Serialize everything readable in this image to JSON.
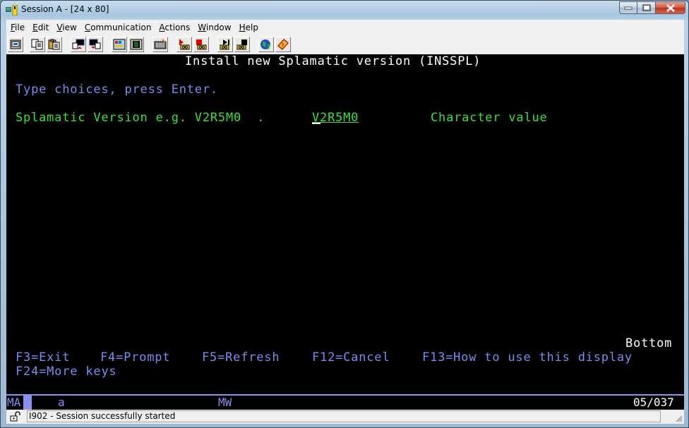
{
  "window": {
    "title": "Session A - [24 x 80]",
    "buttons": {
      "minimize": "minimize",
      "maximize": "maximize",
      "close": "close"
    }
  },
  "menubar": {
    "items": [
      {
        "label": "File",
        "accel": "F",
        "rest": "ile"
      },
      {
        "label": "Edit",
        "accel": "E",
        "rest": "dit"
      },
      {
        "label": "View",
        "accel": "V",
        "rest": "iew"
      },
      {
        "label": "Communication",
        "accel": "C",
        "rest": "ommunication"
      },
      {
        "label": "Actions",
        "accel": "A",
        "rest": "ctions"
      },
      {
        "label": "Window",
        "accel": "W",
        "rest": "indow"
      },
      {
        "label": "Help",
        "accel": "H",
        "rest": "elp"
      }
    ]
  },
  "toolbar": {
    "buttons": [
      "print-screen-icon",
      "copy-icon",
      "paste-icon",
      "send-icon",
      "receive-icon",
      "display-keypad-icon",
      "quick-keypad-icon",
      "keyboard-map-icon",
      "macro-record-icon",
      "macro-stop-icon",
      "macro-play-icon",
      "macro-pause-icon",
      "web-help-icon",
      "help-icon"
    ]
  },
  "terminal": {
    "title": "Install new Splamatic version (INSSPL)",
    "instruction": "Type choices, press Enter.",
    "prompt_label": "Splamatic Version e.g. V2R5M0  .",
    "field_value": "V2R5M0",
    "field_hint": "Character value",
    "more_indicator": "Bottom",
    "fkeys_line1": [
      {
        "label": "F3=Exit"
      },
      {
        "label": "F4=Prompt"
      },
      {
        "label": "F5=Refresh"
      },
      {
        "label": "F12=Cancel"
      },
      {
        "label": "F13=How to use this display"
      }
    ],
    "fkeys_line2": [
      {
        "label": "F24=More keys"
      }
    ],
    "colors": {
      "background": "#000000",
      "title": "#ffffff",
      "instruction": "#7b8cf0",
      "field": "#3ce03c"
    }
  },
  "oia": {
    "mode": "MA",
    "session_letter": "a",
    "status": "MW",
    "cursor_position": "05/037"
  },
  "statusbar": {
    "message": "I902 - Session successfully started"
  }
}
